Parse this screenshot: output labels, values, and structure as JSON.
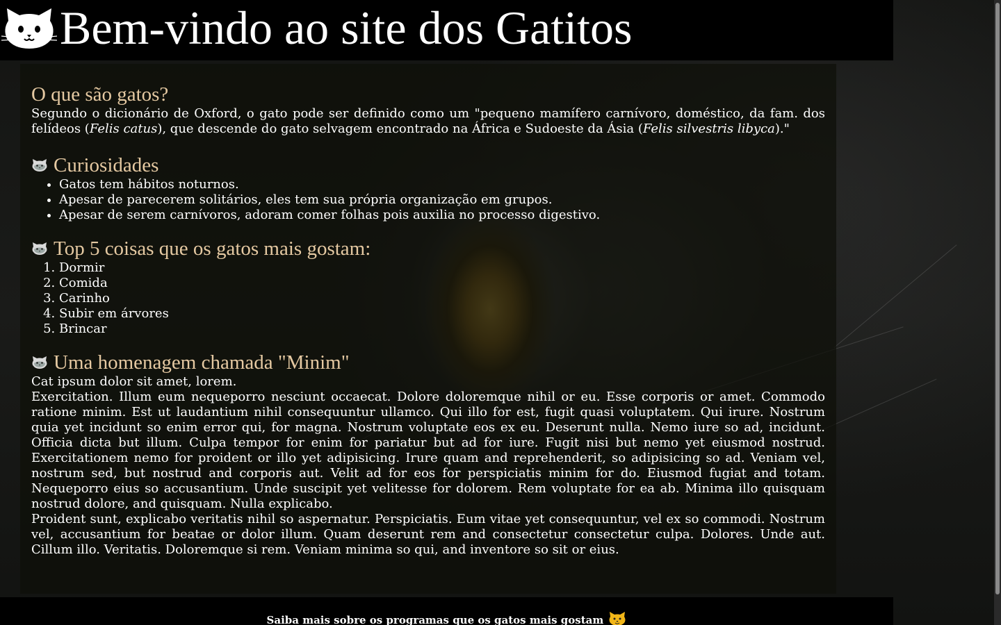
{
  "header": {
    "title": "Bem-vindo ao site dos Gatitos",
    "logo_icon": "cat-face-icon"
  },
  "sections": {
    "what": {
      "heading": "O que são gatos?",
      "text_before_1": "Segundo o dicionário de Oxford, o gato pode ser definido como um \"pequeno mamífero carnívoro, doméstico, da fam. dos felídeos (",
      "species_1": "Felis catus",
      "text_middle": "), que descende do gato selvagem encontrado na África e Sudoeste da Ásia (",
      "species_2": "Felis silvestris libyca",
      "text_after": ").\""
    },
    "curiosities": {
      "heading": "Curiosidades",
      "icon": "cat-face-icon",
      "items": [
        "Gatos tem hábitos noturnos.",
        "Apesar de parecerem solitários, eles tem sua própria organização em grupos.",
        "Apesar de serem carnívoros, adoram comer folhas pois auxilia no processo digestivo."
      ]
    },
    "top5": {
      "heading": "Top 5 coisas que os gatos mais gostam:",
      "icon": "cat-face-icon",
      "items": [
        "Dormir",
        "Comida",
        "Carinho",
        "Subir em árvores",
        "Brincar"
      ]
    },
    "tribute": {
      "heading": "Uma homenagem chamada \"Minim\"",
      "icon": "cat-face-icon",
      "line1": "Cat ipsum dolor sit amet, lorem.",
      "para1": "Exercitation. Illum eum nequeporro nesciunt occaecat. Dolore doloremque nihil or eu. Esse corporis or amet. Commodo ratione minim. Est ut laudantium nihil consequuntur ullamco. Qui illo for est, fugit quasi voluptatem. Qui irure. Nostrum quia yet incidunt so enim error qui, for magna. Nostrum voluptate eos ex eu. Deserunt nulla. Nemo iure so ad, incidunt. Officia dicta but illum. Culpa tempor for enim for pariatur but ad for iure. Fugit nisi but nemo yet eiusmod nostrud. Exercitationem nemo for proident or illo yet adipisicing. Irure quam and reprehenderit, so adipisicing so ad. Veniam vel, nostrum sed, but nostrud and corporis aut. Velit ad for eos for perspiciatis minim for do. Eiusmod fugiat and totam. Nequeporro eius so accusantium. Unde suscipit yet velitesse for dolorem. Rem voluptate for ea ab. Minima illo quisquam nostrud dolore, and quisquam. Nulla explicabo.",
      "para2": "Proident sunt, explicabo veritatis nihil so aspernatur. Perspiciatis. Eum vitae yet consequuntur, vel ex so commodi. Nostrum vel, accusantium for beatae or dolor illum. Quam deserunt rem and consectetur consectetur culpa. Dolores. Unde aut. Cillum illo. Veritatis. Doloremque si rem. Veniam minima so qui, and inventore so sit or eius."
    }
  },
  "footer": {
    "text": "Saiba mais sobre os programas que os gatos mais gostam",
    "icon": "cat-face-icon"
  },
  "colors": {
    "heading_accent": "#e5c9a2",
    "header_bg": "#000000",
    "text": "#ffffff",
    "footer_icon": "#f2b618"
  }
}
